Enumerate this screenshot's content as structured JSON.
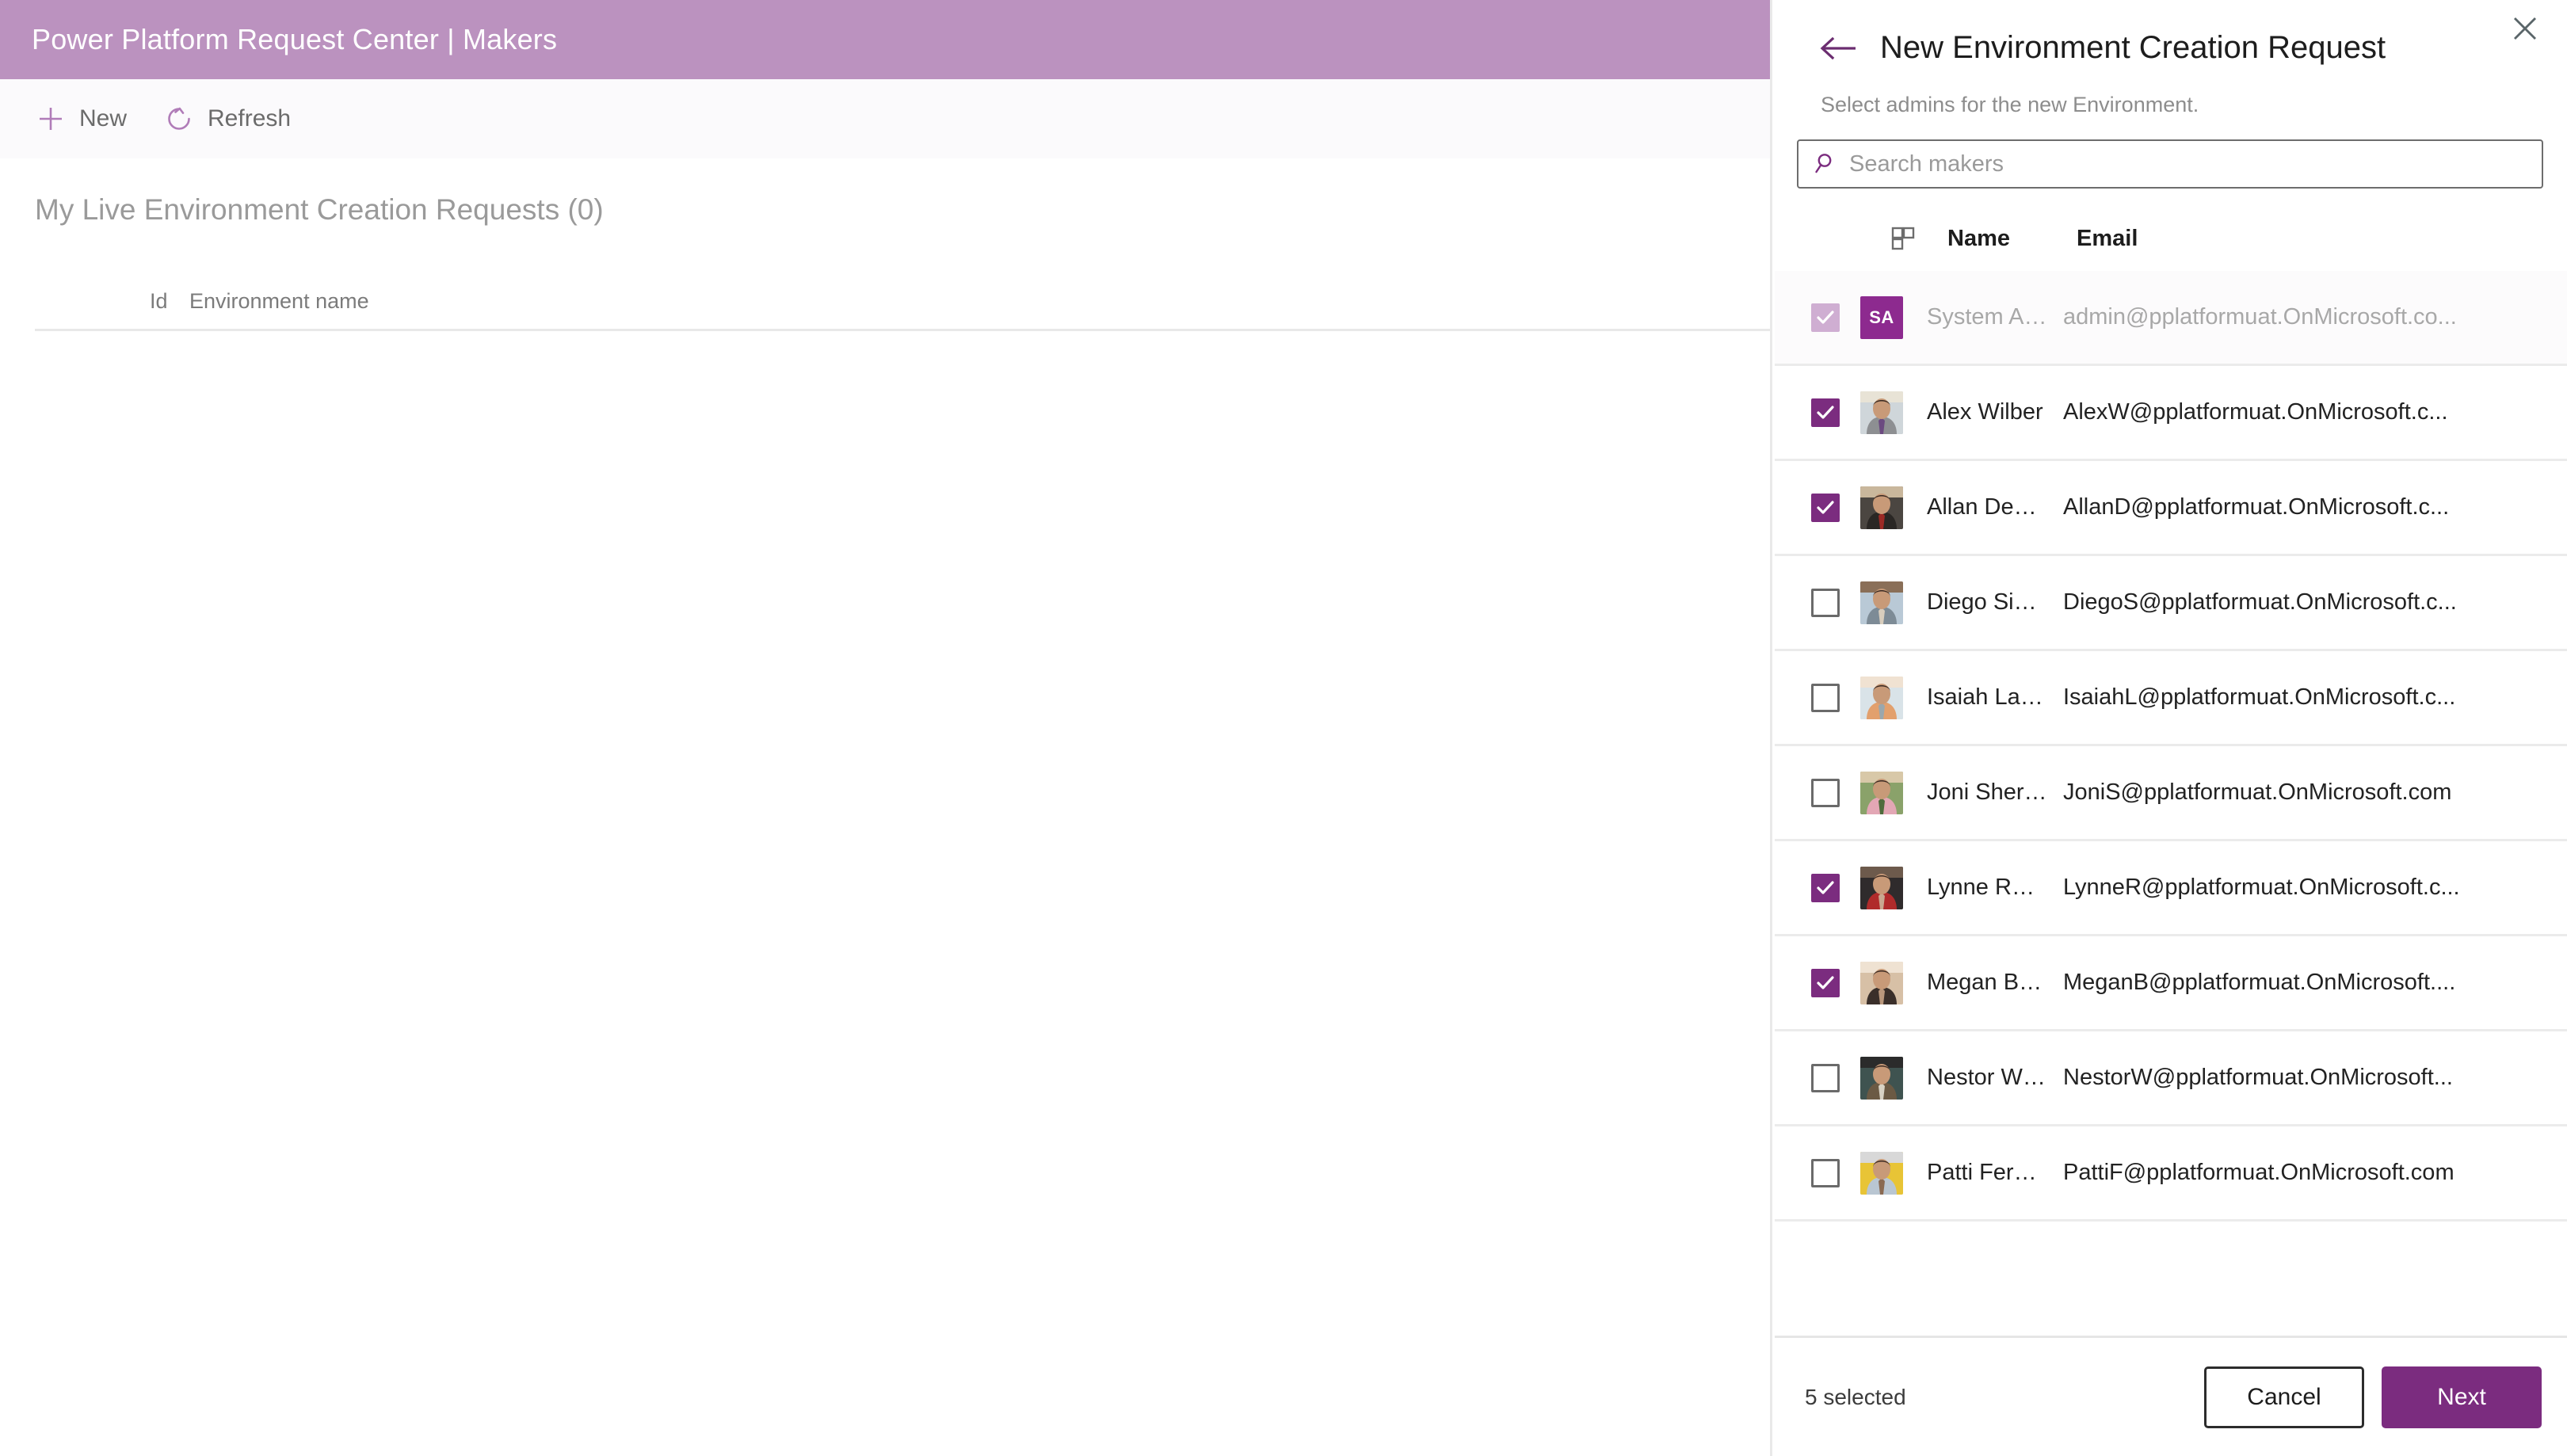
{
  "app": {
    "title": "Power Platform Request Center | Makers",
    "header_color": "#bb92bf",
    "accent_color": "#7b2c7f"
  },
  "command_bar": {
    "items": [
      {
        "label": "New",
        "icon": "plus-icon"
      },
      {
        "label": "Refresh",
        "icon": "refresh-icon"
      }
    ]
  },
  "main": {
    "list_title": "My Live Environment Creation Requests (0)",
    "columns": [
      "Id",
      "Environment name"
    ],
    "rows": []
  },
  "panel": {
    "title": "New Environment Creation Request",
    "subtitle": "Select admins for the new Environment.",
    "back_icon": "back-arrow-icon",
    "close_icon": "close-icon",
    "search": {
      "placeholder": "Search makers",
      "value": "",
      "icon": "search-icon"
    },
    "table": {
      "column_picker_icon": "column-layout-icon",
      "columns": [
        "Name",
        "Email"
      ]
    },
    "makers": [
      {
        "name": "System Administr...",
        "email": "admin@pplatformuat.OnMicrosoft.co...",
        "checked": true,
        "disabled": true,
        "avatar_type": "initials",
        "initials": "SA",
        "avatar_color": "#8d2a8f"
      },
      {
        "name": "Alex Wilber",
        "email": "AlexW@pplatformuat.OnMicrosoft.c...",
        "checked": true,
        "disabled": false,
        "avatar_type": "photo",
        "avatar_photo": "man-grey-shirt-purple-tie"
      },
      {
        "name": "Allan Deyoung",
        "email": "AllanD@pplatformuat.OnMicrosoft.c...",
        "checked": true,
        "disabled": false,
        "avatar_type": "photo",
        "avatar_photo": "man-dark-suit-red-tie"
      },
      {
        "name": "Diego Siciliani",
        "email": "DiegoS@pplatformuat.OnMicrosoft.c...",
        "checked": false,
        "disabled": false,
        "avatar_type": "photo",
        "avatar_photo": "man-light-blue-shirt"
      },
      {
        "name": "Isaiah Langer",
        "email": "IsaiahL@pplatformuat.OnMicrosoft.c...",
        "checked": false,
        "disabled": false,
        "avatar_type": "photo",
        "avatar_photo": "man-orange-shirt-window"
      },
      {
        "name": "Joni Sherman",
        "email": "JoniS@pplatformuat.OnMicrosoft.com",
        "checked": false,
        "disabled": false,
        "avatar_type": "photo",
        "avatar_photo": "woman-pink-jacket-outdoors"
      },
      {
        "name": "Lynne Robbins",
        "email": "LynneR@pplatformuat.OnMicrosoft.c...",
        "checked": true,
        "disabled": false,
        "avatar_type": "photo",
        "avatar_photo": "woman-black-jacket-red-top"
      },
      {
        "name": "Megan Bowen",
        "email": "MeganB@pplatformuat.OnMicrosoft....",
        "checked": true,
        "disabled": false,
        "avatar_type": "photo",
        "avatar_photo": "woman-glasses-smiling"
      },
      {
        "name": "Nestor Wilke",
        "email": "NestorW@pplatformuat.OnMicrosoft...",
        "checked": false,
        "disabled": false,
        "avatar_type": "photo",
        "avatar_photo": "man-glasses-chalkboard"
      },
      {
        "name": "Patti Fernandez",
        "email": "PattiF@pplatformuat.OnMicrosoft.com",
        "checked": false,
        "disabled": false,
        "avatar_type": "photo",
        "avatar_photo": "woman-yellow-jacket-city"
      }
    ],
    "footer": {
      "selected_text": "5 selected",
      "cancel_label": "Cancel",
      "next_label": "Next"
    }
  }
}
